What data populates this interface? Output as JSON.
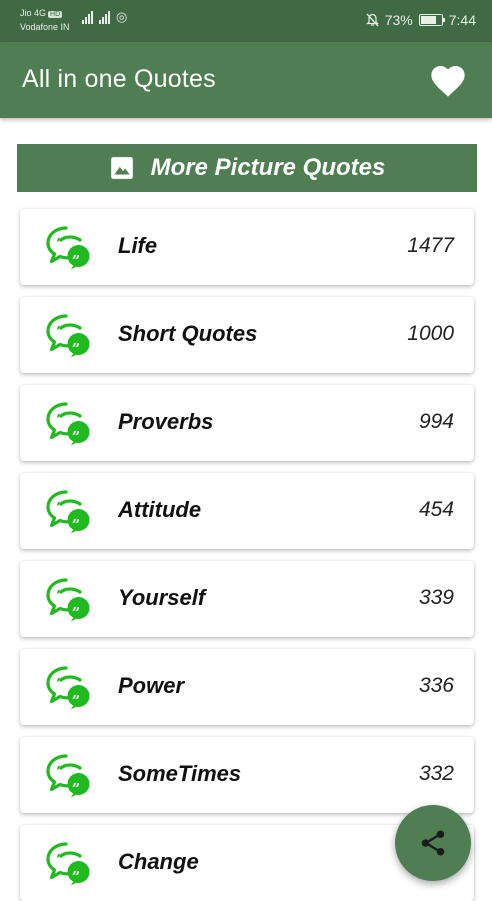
{
  "status_bar": {
    "carrier_1": "Jio 4G",
    "carrier_1_badge": "HD",
    "carrier_2": "Vodafone IN",
    "battery_text": "73%",
    "battery_level": 0.73,
    "time": "7:44"
  },
  "app_bar": {
    "title": "All in one Quotes",
    "favorite_icon": "heart-icon"
  },
  "picture_button": {
    "label": "More Picture Quotes",
    "icon": "image-icon"
  },
  "categories": [
    {
      "name": "Life",
      "count": "1477"
    },
    {
      "name": "Short Quotes",
      "count": "1000"
    },
    {
      "name": "Proverbs",
      "count": "994"
    },
    {
      "name": "Attitude",
      "count": "454"
    },
    {
      "name": "Yourself",
      "count": "339"
    },
    {
      "name": "Power",
      "count": "336"
    },
    {
      "name": "SomeTimes",
      "count": "332"
    },
    {
      "name": "Change",
      "count": ""
    }
  ],
  "fab": {
    "icon": "share-icon"
  },
  "colors": {
    "status_bar": "#3f6a43",
    "primary": "#4e7e52",
    "quote_icon": "#20b91f"
  }
}
